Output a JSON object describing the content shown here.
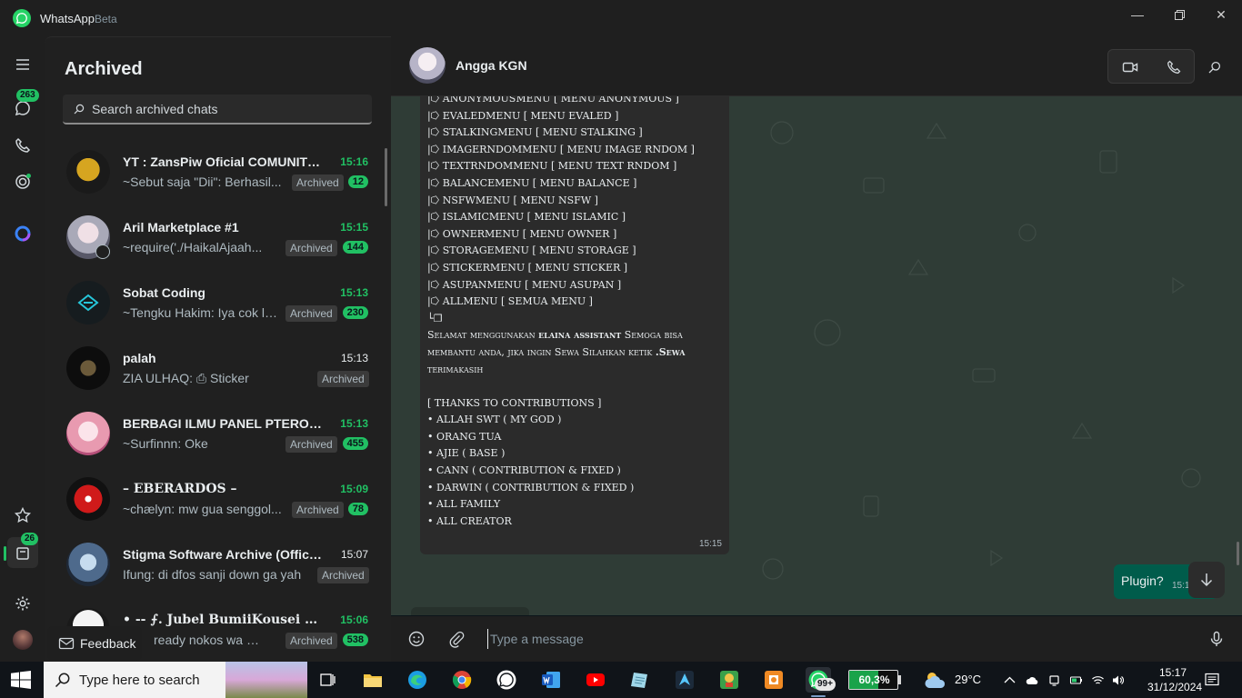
{
  "titlebar": {
    "app_name": "WhatsApp",
    "beta_label": "Beta"
  },
  "rail": {
    "chats_badge": "263",
    "archived_badge": "26"
  },
  "sidebar": {
    "title": "Archived",
    "search_placeholder": "Search archived chats",
    "feedback_label": "Feedback",
    "chats": [
      {
        "name": "YT : ZansPiw Oficial COMUNITY...",
        "time": "15:16",
        "time_unread": true,
        "preview": "~Sebut saja \"Dii\": Berhasil...",
        "tag": "Archived",
        "count": "12"
      },
      {
        "name": "Aril Marketplace #1",
        "time": "15:15",
        "time_unread": true,
        "preview": "~require('./HaikalAjaah...",
        "tag": "Archived",
        "count": "144"
      },
      {
        "name": "Sobat Coding",
        "time": "15:13",
        "time_unread": true,
        "preview": "~Tengku Hakim: Iya cok le...",
        "tag": "Archived",
        "count": "230"
      },
      {
        "name": "palah",
        "time": "15:13",
        "time_unread": false,
        "preview": "ZIA ULHAQ: ⎙ Sticker",
        "tag": "Archived",
        "count": ""
      },
      {
        "name": "BERBAGI ILMU PANEL PTERODAC...",
        "time": "15:13",
        "time_unread": true,
        "preview": "~Surfinnn: Oke",
        "tag": "Archived",
        "count": "455"
      },
      {
        "name": "– EBERARDOS –",
        "time": "15:09",
        "time_unread": true,
        "preview": "~chælyn: mw gua senggol...",
        "tag": "Archived",
        "count": "78"
      },
      {
        "name": "Stigma Software Archive (Official...",
        "time": "15:07",
        "time_unread": false,
        "preview": "Ifung: di dfos sanji down ga yah",
        "tag": "Archived",
        "count": ""
      },
      {
        "name": "• -- ⨍. Jubel BumiiKousei ▸ .....",
        "time": "15:06",
        "time_unread": true,
        "preview": "ready nokos wa 🇮🇩...",
        "tag": "Archived",
        "count": "538"
      }
    ]
  },
  "chat": {
    "contact_name": "Angga KGN",
    "menu_lines": [
      "|⭔ ANONYMOUSMENU [ MENU ANONYMOUS ]",
      "|⭔ EVALEDMENU [ MENU EVALED ]",
      "|⭔ STALKINGMENU [ MENU STALKING ]",
      "|⭔ IMAGERNDOMMENU [ MENU IMAGE RNDOM ]",
      "|⭔ TEXTRNDOMMENU [ MENU TEXT RNDOM ]",
      "|⭔ BALANCEMENU [ MENU BALANCE ]",
      "|⭔ NSFWMENU [ MENU NSFW ]",
      "|⭔ ISLAMICMENU [ MENU ISLAMIC ]",
      "|⭔ OWNERMENU [ MENU OWNER ]",
      "|⭔ STORAGEMENU [ MENU STORAGE ]",
      "|⭔ STICKERMENU [ MENU STICKER ]",
      "|⭔ ASUPANMENU [ MENU ASUPAN ]",
      "|⭔ ALLMENU [ SEMUA MENU ]",
      "└❐"
    ],
    "closing_1a": "Selamat menggunakan ",
    "closing_1b": "elaina assistant",
    "closing_1c": " Semoga bisa",
    "closing_2a": "membantu anda, jika ingin Sewa Silahkan ketik  ",
    "closing_2b": ".Sewa",
    "closing_3": "terimakasih",
    "thanks_lines": [
      "[ THANKS TO CONTRIBUTIONS ]",
      "• ALLAH SWT ( MY GOD )",
      "• ORANG TUA",
      "• AJIE ( BASE )",
      "• CANN ( CONTRIBUTION & FIXED )",
      "• DARWIN ( CONTRIBUTION & FIXED )",
      "• ALL FAMILY",
      "• ALL CREATOR"
    ],
    "incoming_time": "15:15",
    "outgoing_text": "Plugin?",
    "outgoing_time": "15:16",
    "composer_placeholder": "Type a message"
  },
  "taskbar": {
    "search_placeholder": "Type here to search",
    "whatsapp_badge": "99+",
    "battery_percent": "60,3%",
    "battery_level": 0.603,
    "temperature": "29°C",
    "time": "15:17",
    "date": "31/12/2024"
  },
  "colors": {
    "accent": "#21c063",
    "outgoing_bubble": "#005c4b",
    "wallpaper": "#2f3c36"
  }
}
